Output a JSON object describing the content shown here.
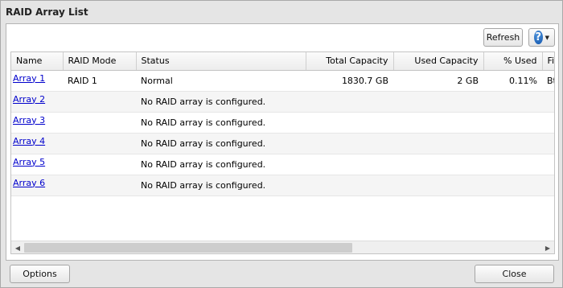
{
  "dialog": {
    "title": "RAID Array List",
    "refresh_label": "Refresh",
    "help_symbol": "?",
    "options_label": "Options",
    "close_label": "Close"
  },
  "table": {
    "headers": [
      "Name",
      "RAID Mode",
      "Status",
      "Total Capacity",
      "Used Capacity",
      "% Used",
      "File"
    ],
    "rows": [
      {
        "name": "Array 1",
        "mode": "RAID 1",
        "status": "Normal",
        "total": "1830.7 GB",
        "used": "2 GB",
        "pct": "0.11%",
        "fs": "Btrfs"
      },
      {
        "name": "Array 2",
        "mode": "",
        "status": "No RAID array is configured.",
        "total": "",
        "used": "",
        "pct": "",
        "fs": ""
      },
      {
        "name": "Array 3",
        "mode": "",
        "status": "No RAID array is configured.",
        "total": "",
        "used": "",
        "pct": "",
        "fs": ""
      },
      {
        "name": "Array 4",
        "mode": "",
        "status": "No RAID array is configured.",
        "total": "",
        "used": "",
        "pct": "",
        "fs": ""
      },
      {
        "name": "Array 5",
        "mode": "",
        "status": "No RAID array is configured.",
        "total": "",
        "used": "",
        "pct": "",
        "fs": ""
      },
      {
        "name": "Array 6",
        "mode": "",
        "status": "No RAID array is configured.",
        "total": "",
        "used": "",
        "pct": "",
        "fs": ""
      }
    ]
  },
  "icons": {
    "help": "help-icon",
    "dropdown": "chevron-down-icon",
    "scroll_left": "scroll-left-arrow-icon",
    "scroll_right": "scroll-right-arrow-icon"
  },
  "colors": {
    "link": "#0000cc",
    "help_icon": "#1559b0"
  }
}
